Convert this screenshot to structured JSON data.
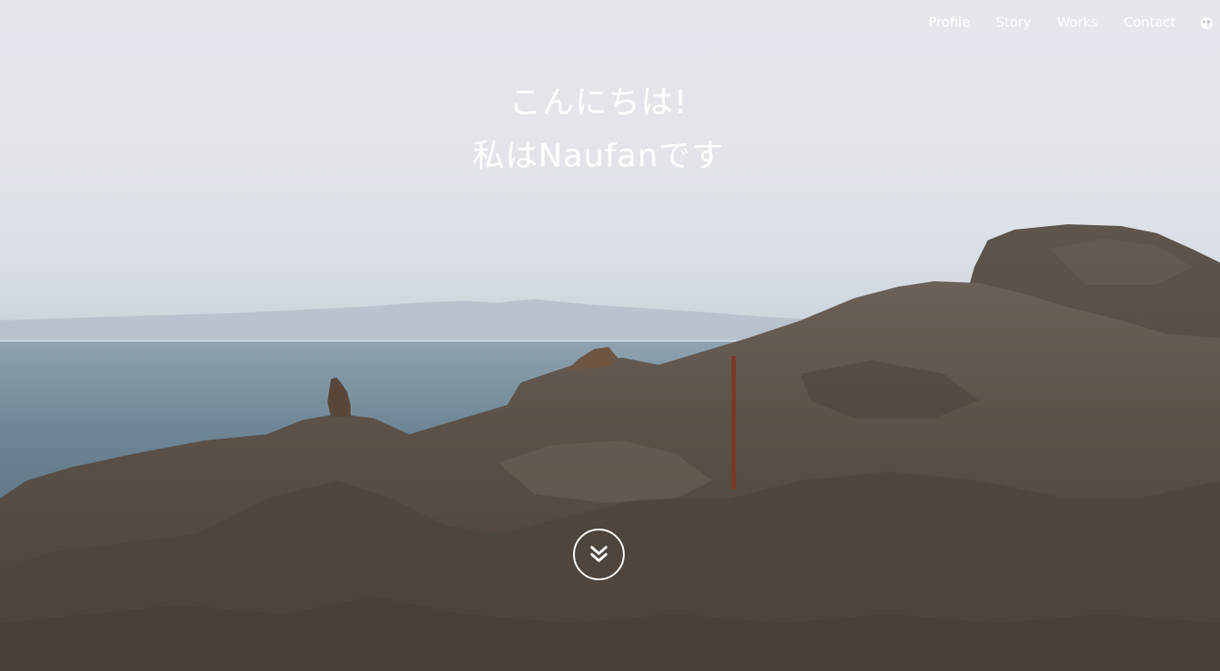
{
  "nav": {
    "items": [
      {
        "label": "Profile"
      },
      {
        "label": "Story"
      },
      {
        "label": "Works"
      },
      {
        "label": "Contact"
      }
    ],
    "language_icon": "globe-icon"
  },
  "hero": {
    "greeting_line1": "こんにちは!",
    "greeting_line2": "私はNaufanです",
    "scroll_icon": "double-chevron-down-icon"
  },
  "colors": {
    "sky": "#e1e5ea",
    "sea": "#6f8796",
    "rock": "#5a5149",
    "text": "#ffffff"
  }
}
